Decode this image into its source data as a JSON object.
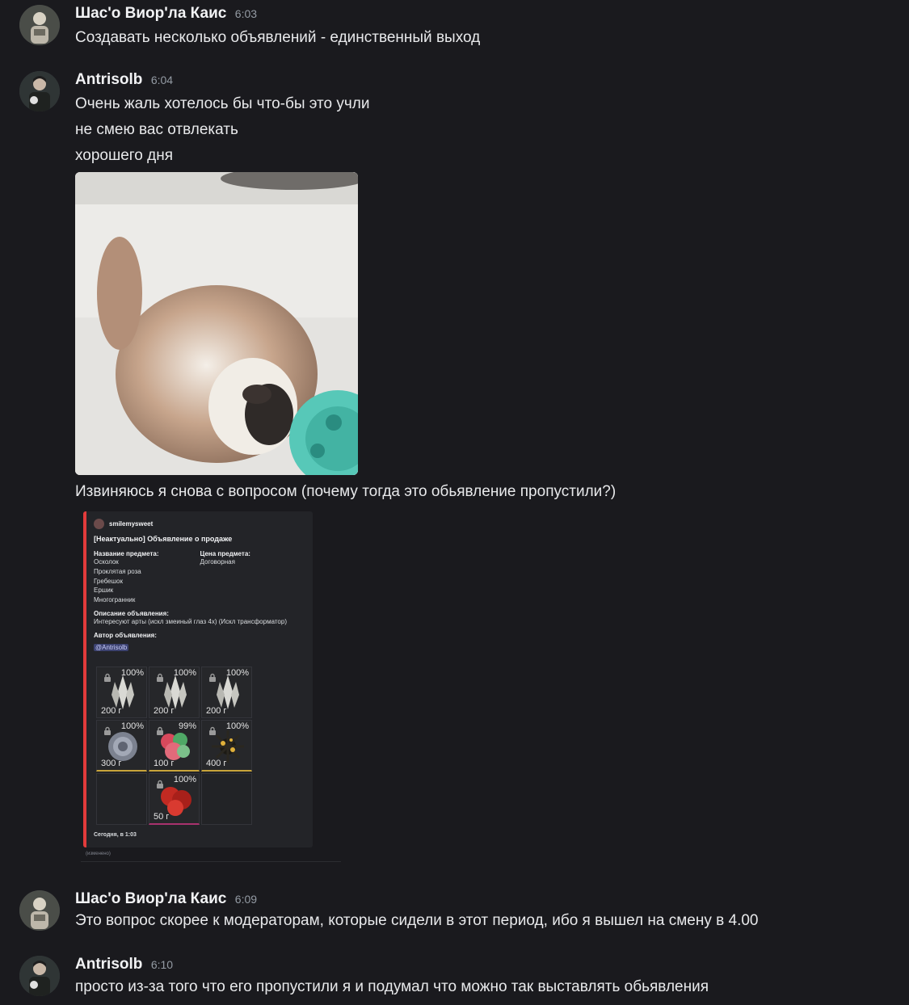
{
  "messages": [
    {
      "username": "Шас'о Виор'ла Каис",
      "time": "6:03",
      "lines": [
        "Создавать несколько объявлений - единственный выход"
      ]
    },
    {
      "username": "Antrisolb",
      "time": "6:04",
      "lines": [
        "Очень жаль хотелось бы что-бы это учли",
        "не смею вас отвлекать",
        "хорошего дня"
      ],
      "after_image_text": "Извиняюсь я снова с вопросом (почему тогда это обьявление пропустили?)"
    },
    {
      "username": "Шас'о Виор'ла Каис",
      "time": "6:09",
      "lines": [
        "Это вопрос скорее к модераторам, которые сидели в этот период, ибо я вышел на смену в 4.00"
      ]
    },
    {
      "username": "Antrisolb",
      "time": "6:10",
      "lines": [
        "просто из-за того  что его пропустили я и подумал что можно так выставлять обьявления"
      ]
    }
  ],
  "embed": {
    "author": "smilemysweet",
    "title": "[Неактуально] Объявление о продаже",
    "item_field_label": "Название предмета:",
    "items": [
      "Осколок",
      "Проклятая роза",
      "Гребешок",
      "Ершик",
      "Многогранник"
    ],
    "price_field_label": "Цена предмета:",
    "price_value": "Договорная",
    "description_label": "Описание объявления:",
    "description": "Интересуют арты (искл змеиный глаз 4х) (Искл трансформатор)",
    "author_label": "Автор объявления:",
    "author_mention": "@Antrisolb",
    "footer": "Сегодня, в 1:03",
    "edited": "(изменено)",
    "accent_color": "#e23b3b",
    "grid": [
      {
        "pct": "100%",
        "price": "200 г",
        "art": "crystal-icon",
        "rarity": "none"
      },
      {
        "pct": "100%",
        "price": "200 г",
        "art": "crystal-icon",
        "rarity": "none"
      },
      {
        "pct": "100%",
        "price": "200 г",
        "art": "crystal-icon",
        "rarity": "none"
      },
      {
        "pct": "100%",
        "price": "300 г",
        "art": "rose-icon",
        "rarity": "gold"
      },
      {
        "pct": "99%",
        "price": "100 г",
        "art": "flower-cluster-icon",
        "rarity": "gold"
      },
      {
        "pct": "100%",
        "price": "400 г",
        "art": "spiky-orb-icon",
        "rarity": "gold"
      },
      {
        "pct": "",
        "price": "",
        "art": "",
        "rarity": "empty"
      },
      {
        "pct": "100%",
        "price": "50 г",
        "art": "red-cluster-icon",
        "rarity": "pink"
      },
      {
        "pct": "",
        "price": "",
        "art": "",
        "rarity": "empty"
      }
    ]
  }
}
